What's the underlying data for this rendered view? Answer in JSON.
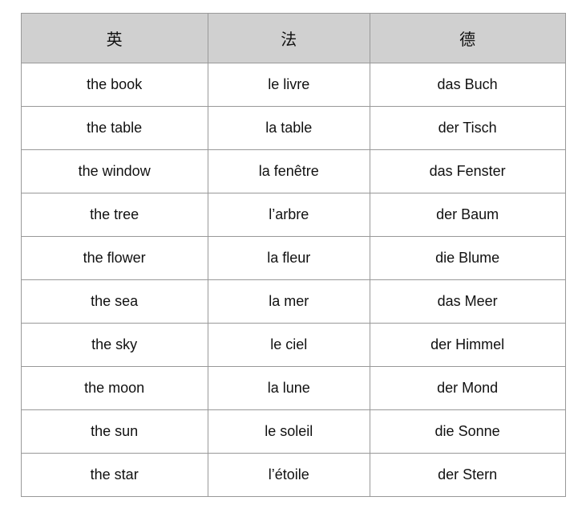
{
  "table": {
    "headers": [
      {
        "label": "英",
        "key": "english"
      },
      {
        "label": "法",
        "key": "french"
      },
      {
        "label": "德",
        "key": "german"
      }
    ],
    "rows": [
      {
        "english": "the book",
        "french": "le livre",
        "german": "das Buch"
      },
      {
        "english": "the table",
        "french": "la table",
        "german": "der Tisch"
      },
      {
        "english": "the window",
        "french": "la fenêtre",
        "german": "das Fenster"
      },
      {
        "english": "the tree",
        "french": "l’arbre",
        "german": "der Baum"
      },
      {
        "english": "the flower",
        "french": "la fleur",
        "german": "die Blume"
      },
      {
        "english": "the sea",
        "french": "la mer",
        "german": "das Meer"
      },
      {
        "english": "the sky",
        "french": "le ciel",
        "german": "der Himmel"
      },
      {
        "english": "the moon",
        "french": "la lune",
        "german": "der Mond"
      },
      {
        "english": "the sun",
        "french": "le soleil",
        "german": "die Sonne"
      },
      {
        "english": "the star",
        "french": "l’étoile",
        "german": "der Stern"
      }
    ]
  }
}
